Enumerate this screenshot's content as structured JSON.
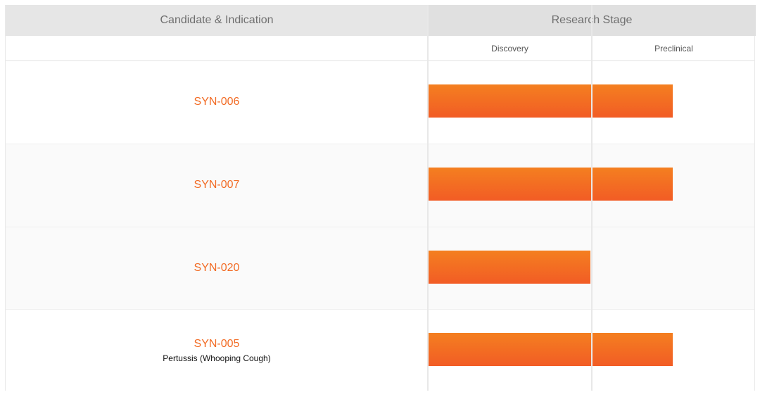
{
  "header": {
    "candidate_col": "Candidate & Indication",
    "stage_col": "Research Stage"
  },
  "stages": [
    "Discovery",
    "Preclinical"
  ],
  "colors": {
    "accent": "#f26b24",
    "bar_top": "#f47f20",
    "bar_bottom": "#f25c25",
    "header_bg": "#e6e6e6"
  },
  "rows": [
    {
      "name": "SYN-006",
      "indication": "",
      "progress_stages": 1.5
    },
    {
      "name": "SYN-007",
      "indication": "",
      "progress_stages": 1.5
    },
    {
      "name": "SYN-020",
      "indication": "",
      "progress_stages": 1.0
    },
    {
      "name": "SYN-005",
      "indication": "Pertussis (Whooping Cough)",
      "progress_stages": 1.5
    }
  ]
}
